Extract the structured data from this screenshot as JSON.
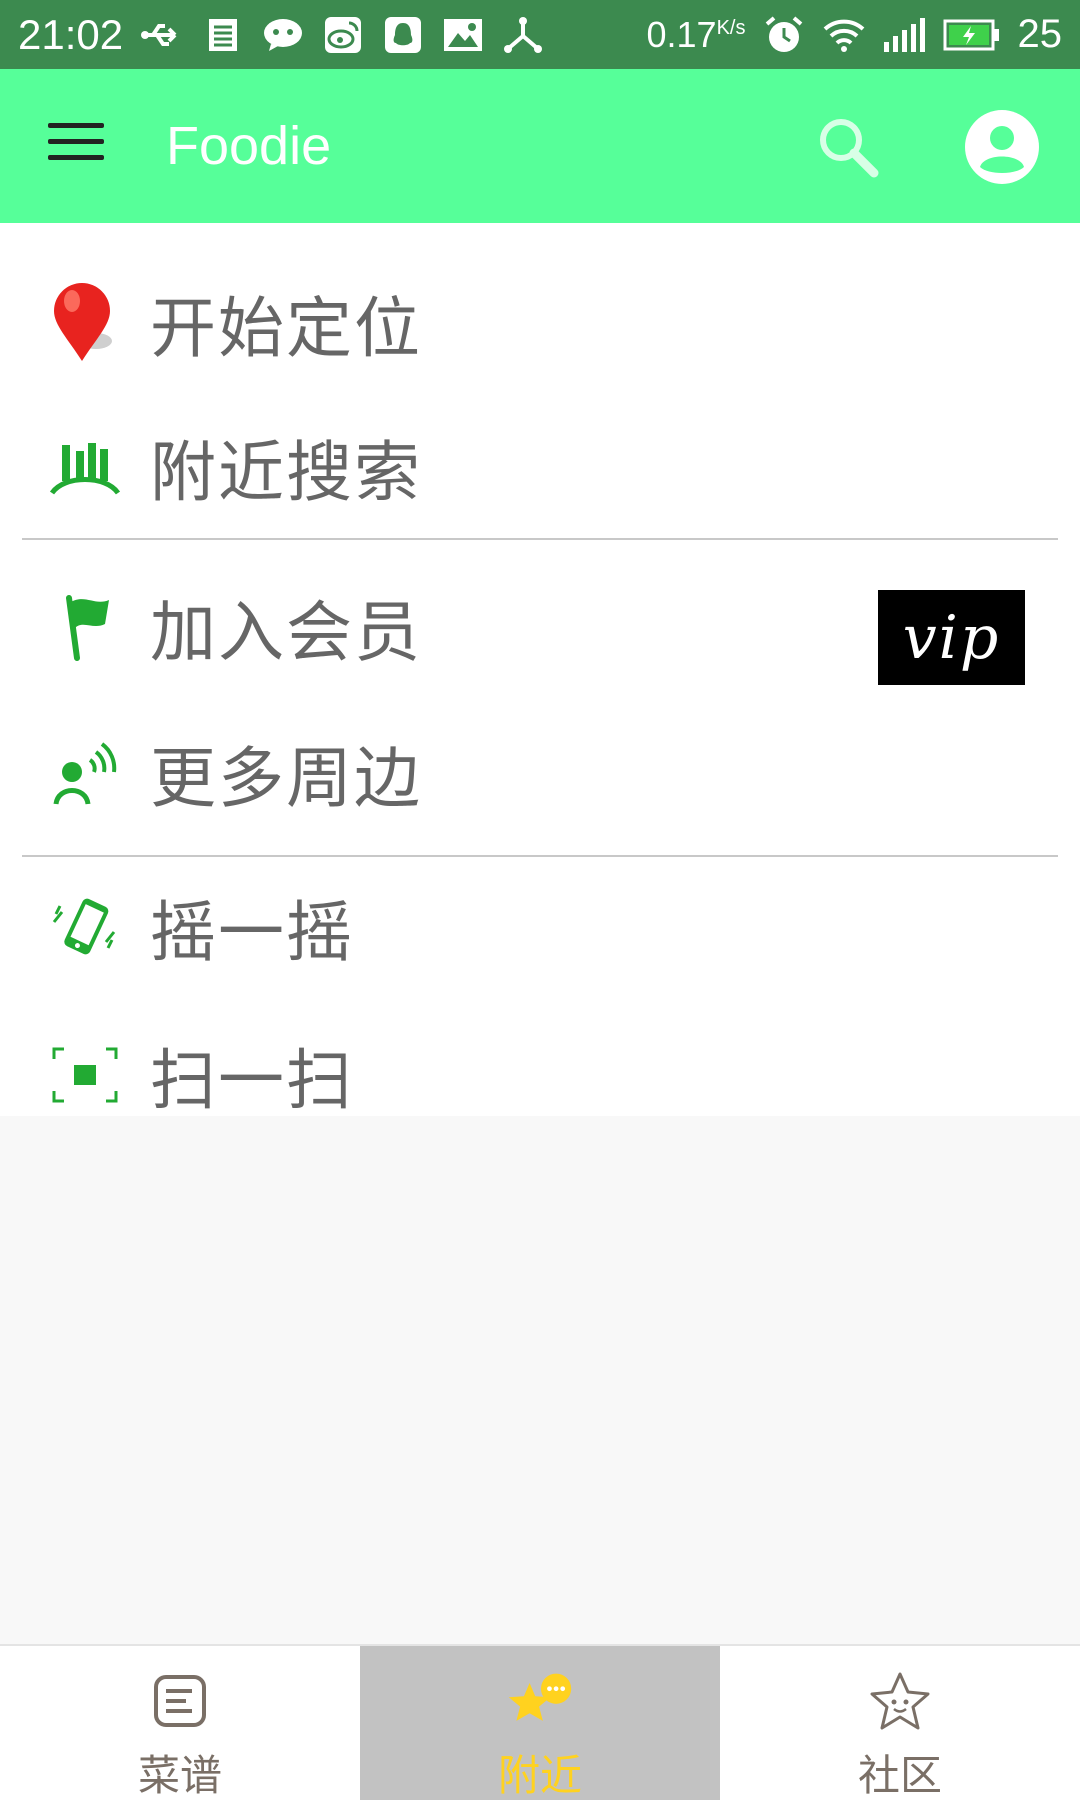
{
  "status_bar": {
    "time": "21:02",
    "net_speed": "0.17",
    "net_speed_unit": "K/s",
    "battery_level": "25",
    "icons": [
      "usb-icon",
      "notes-icon",
      "wechat-icon",
      "weibo-icon",
      "qq-icon",
      "gallery-icon",
      "share-icon",
      "alarm-icon",
      "wifi-icon",
      "signal-icon",
      "battery-charging-icon"
    ]
  },
  "app_bar": {
    "title": "Foodie",
    "menu_icon": "hamburger-icon",
    "search_icon": "search-icon",
    "account_icon": "account-icon"
  },
  "menu": {
    "items": [
      {
        "label": "开始定位",
        "icon": "location-pin-icon"
      },
      {
        "label": "附近搜索",
        "icon": "nearby-search-icon"
      },
      {
        "label": "加入会员",
        "icon": "flag-icon",
        "badge": "vip"
      },
      {
        "label": "更多周边",
        "icon": "broadcast-person-icon"
      },
      {
        "label": "摇一摇",
        "icon": "shake-phone-icon"
      },
      {
        "label": "扫一扫",
        "icon": "scan-icon"
      }
    ]
  },
  "bottom_nav": {
    "tabs": [
      {
        "label": "菜谱",
        "icon": "recipe-icon",
        "active": false
      },
      {
        "label": "附近",
        "icon": "nearby-star-icon",
        "active": true
      },
      {
        "label": "社区",
        "icon": "community-star-icon",
        "active": false
      }
    ]
  },
  "colors": {
    "status_bar": "#3c8a4f",
    "app_bar": "#56ff99",
    "accent_green": "#22aa33",
    "active_tab_bg": "#c2c2c2",
    "active_tab_text": "#ffd21f",
    "inactive_tab_text": "#7a6f66"
  }
}
